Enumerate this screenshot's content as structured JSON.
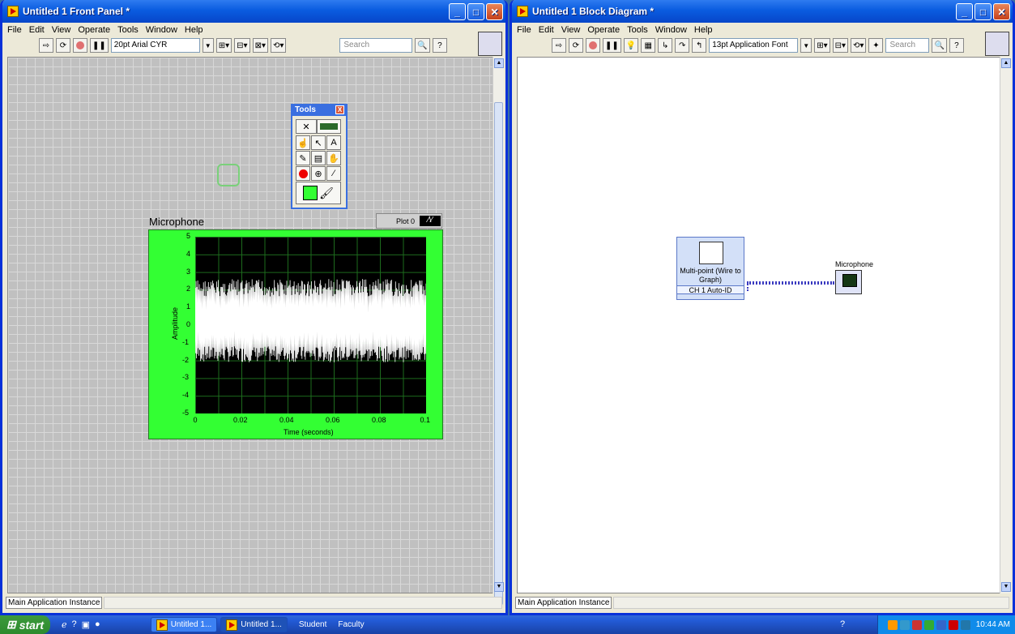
{
  "front_panel": {
    "title": "Untitled 1 Front Panel *",
    "menu": [
      "File",
      "Edit",
      "View",
      "Operate",
      "Tools",
      "Window",
      "Help"
    ],
    "font_select": "20pt Arial CYR",
    "search_placeholder": "Search",
    "status_instance": "Main Application Instance",
    "graph": {
      "label": "Microphone",
      "legend": "Plot 0",
      "ylabel": "Amplitude",
      "xlabel": "Time (seconds)",
      "yticks": [
        "5",
        "4",
        "3",
        "2",
        "1",
        "0",
        "-1",
        "-2",
        "-3",
        "-4",
        "-5"
      ],
      "xticks": [
        "0",
        "0.02",
        "0.04",
        "0.06",
        "0.08",
        "0.1"
      ],
      "plot_color": "#ffffff",
      "bg_color": "#33ff33"
    },
    "tools_palette": {
      "title": "Tools",
      "close": "X"
    }
  },
  "block_diagram": {
    "title": "Untitled 1 Block Diagram *",
    "menu": [
      "File",
      "Edit",
      "View",
      "Operate",
      "Tools",
      "Window",
      "Help"
    ],
    "font_select": "13pt Application Font",
    "search_placeholder": "Search",
    "status_instance": "Main Application Instance",
    "express_vi": {
      "label": "Multi-point (Wire to Graph)",
      "channel": "CH 1 Auto-ID"
    },
    "graph_terminal": {
      "label": "Microphone"
    }
  },
  "taskbar": {
    "start": "start",
    "tasks": [
      "Untitled 1...",
      "Untitled 1..."
    ],
    "bands": [
      "Student",
      "Faculty"
    ],
    "clock": "10:44 AM"
  },
  "chart_data": {
    "type": "line",
    "title": "Microphone",
    "xlabel": "Time (seconds)",
    "ylabel": "Amplitude",
    "xlim": [
      0,
      0.1
    ],
    "ylim": [
      -5,
      5
    ],
    "series": [
      {
        "name": "Plot 0",
        "description_range": [
          -2.1,
          2.6
        ]
      }
    ],
    "grid": true
  }
}
